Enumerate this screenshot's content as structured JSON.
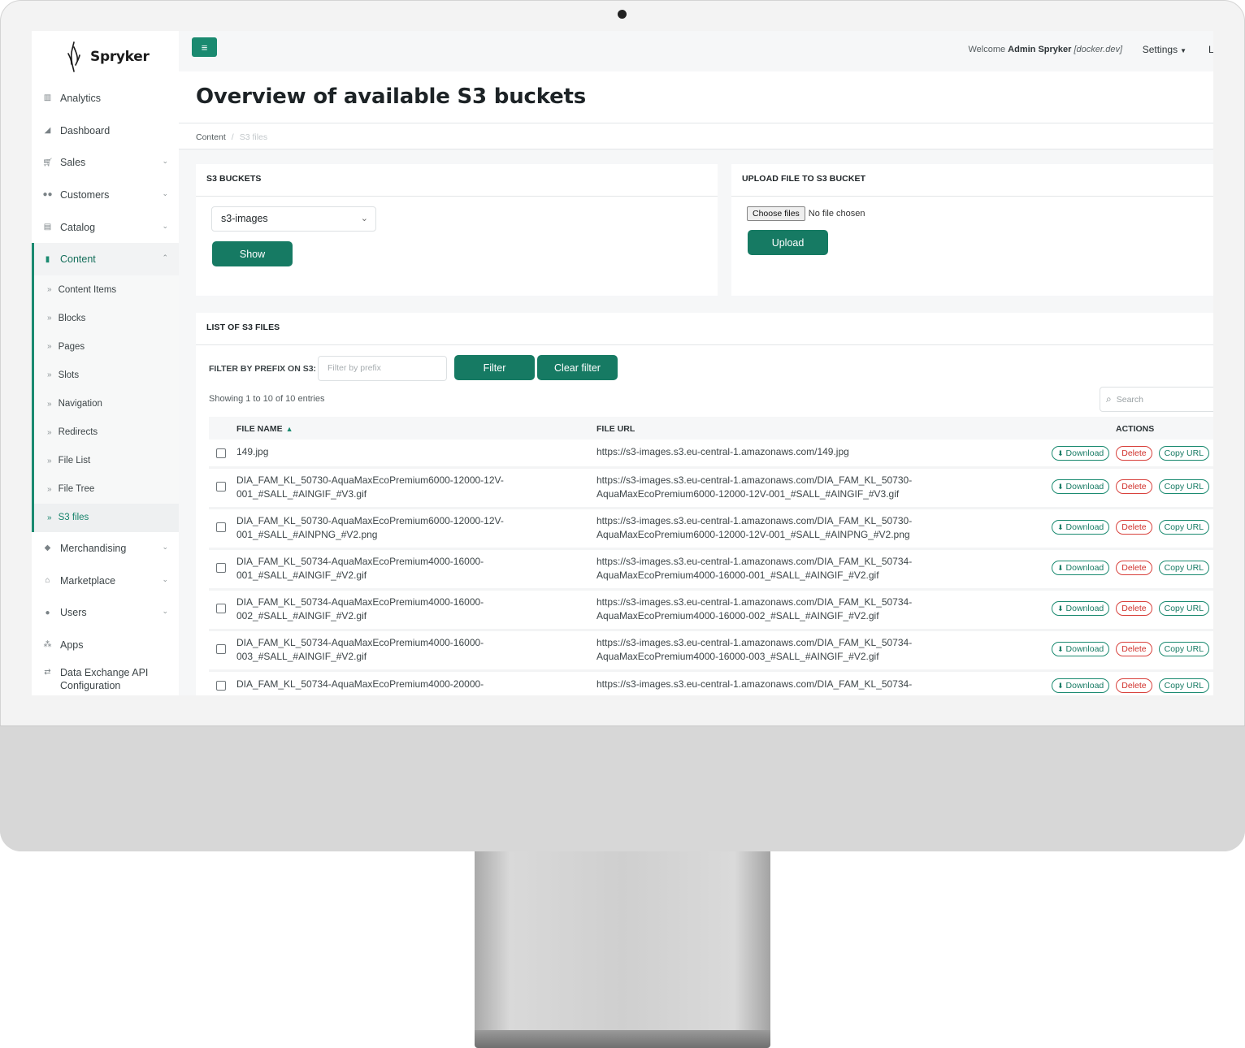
{
  "brand": {
    "name": "Spryker"
  },
  "header": {
    "welcome_prefix": "Welcome",
    "user": "Admin Spryker",
    "env": "[docker.dev]",
    "settings": "Settings",
    "logout_truncated": "L"
  },
  "sidebar": {
    "items": [
      {
        "label": "Analytics",
        "icon": "bar-chart-icon"
      },
      {
        "label": "Dashboard",
        "icon": "area-chart-icon"
      },
      {
        "label": "Sales",
        "icon": "cart-icon"
      },
      {
        "label": "Customers",
        "icon": "users-icon"
      },
      {
        "label": "Catalog",
        "icon": "book-icon"
      },
      {
        "label": "Content",
        "icon": "file-icon"
      },
      {
        "label": "Merchandising",
        "icon": "tags-icon"
      },
      {
        "label": "Marketplace",
        "icon": "bank-icon"
      },
      {
        "label": "Users",
        "icon": "user-icon"
      },
      {
        "label": "Apps",
        "icon": "apps-icon"
      },
      {
        "label": "Data Exchange API Configuration",
        "icon": "exchange-icon"
      }
    ],
    "content_sub": [
      "Content Items",
      "Blocks",
      "Pages",
      "Slots",
      "Navigation",
      "Redirects",
      "File List",
      "File Tree",
      "S3 files"
    ]
  },
  "page": {
    "title": "Overview of available S3 buckets",
    "breadcrumb": [
      "Content",
      "S3 files"
    ]
  },
  "buckets": {
    "heading": "S3 BUCKETS",
    "selected": "s3-images",
    "show_label": "Show"
  },
  "upload": {
    "heading": "UPLOAD FILE TO S3 BUCKET",
    "choose_label": "Choose files",
    "no_file": "No file chosen",
    "upload_label": "Upload"
  },
  "list": {
    "heading": "LIST OF S3 FILES",
    "filter_label": "FILTER BY PREFIX ON S3:",
    "filter_placeholder": "Filter by prefix",
    "filter_btn": "Filter",
    "clear_btn": "Clear filter",
    "entries": "Showing 1 to 10 of 10 entries",
    "search_placeholder": "Search",
    "columns": [
      "FILE NAME",
      "FILE URL",
      "ACTIONS"
    ],
    "actions": {
      "download": "Download",
      "delete": "Delete",
      "copy": "Copy URL"
    },
    "rows": [
      {
        "name": [
          "149.jpg"
        ],
        "url": [
          "https://s3-images.s3.eu-central-1.amazonaws.com/149.jpg"
        ]
      },
      {
        "name": [
          "DIA_FAM_KL_50730-AquaMaxEcoPremium6000-12000-12V-",
          "001_#SALL_#AINGIF_#V3.gif"
        ],
        "url": [
          "https://s3-images.s3.eu-central-1.amazonaws.com/DIA_FAM_KL_50730-",
          "AquaMaxEcoPremium6000-12000-12V-001_#SALL_#AINGIF_#V3.gif"
        ]
      },
      {
        "name": [
          "DIA_FAM_KL_50730-AquaMaxEcoPremium6000-12000-12V-",
          "001_#SALL_#AINPNG_#V2.png"
        ],
        "url": [
          "https://s3-images.s3.eu-central-1.amazonaws.com/DIA_FAM_KL_50730-",
          "AquaMaxEcoPremium6000-12000-12V-001_#SALL_#AINPNG_#V2.png"
        ]
      },
      {
        "name": [
          "DIA_FAM_KL_50734-AquaMaxEcoPremium4000-16000-",
          "001_#SALL_#AINGIF_#V2.gif"
        ],
        "url": [
          "https://s3-images.s3.eu-central-1.amazonaws.com/DIA_FAM_KL_50734-",
          "AquaMaxEcoPremium4000-16000-001_#SALL_#AINGIF_#V2.gif"
        ]
      },
      {
        "name": [
          "DIA_FAM_KL_50734-AquaMaxEcoPremium4000-16000-",
          "002_#SALL_#AINGIF_#V2.gif"
        ],
        "url": [
          "https://s3-images.s3.eu-central-1.amazonaws.com/DIA_FAM_KL_50734-",
          "AquaMaxEcoPremium4000-16000-002_#SALL_#AINGIF_#V2.gif"
        ]
      },
      {
        "name": [
          "DIA_FAM_KL_50734-AquaMaxEcoPremium4000-16000-",
          "003_#SALL_#AINGIF_#V2.gif"
        ],
        "url": [
          "https://s3-images.s3.eu-central-1.amazonaws.com/DIA_FAM_KL_50734-",
          "AquaMaxEcoPremium4000-16000-003_#SALL_#AINGIF_#V2.gif"
        ]
      },
      {
        "name": [
          "DIA_FAM_KL_50734-AquaMaxEcoPremium4000-20000-"
        ],
        "url": [
          "https://s3-images.s3.eu-central-1.amazonaws.com/DIA_FAM_KL_50734-"
        ]
      }
    ]
  },
  "colors": {
    "accent": "#167a63",
    "danger": "#d02f2a"
  }
}
